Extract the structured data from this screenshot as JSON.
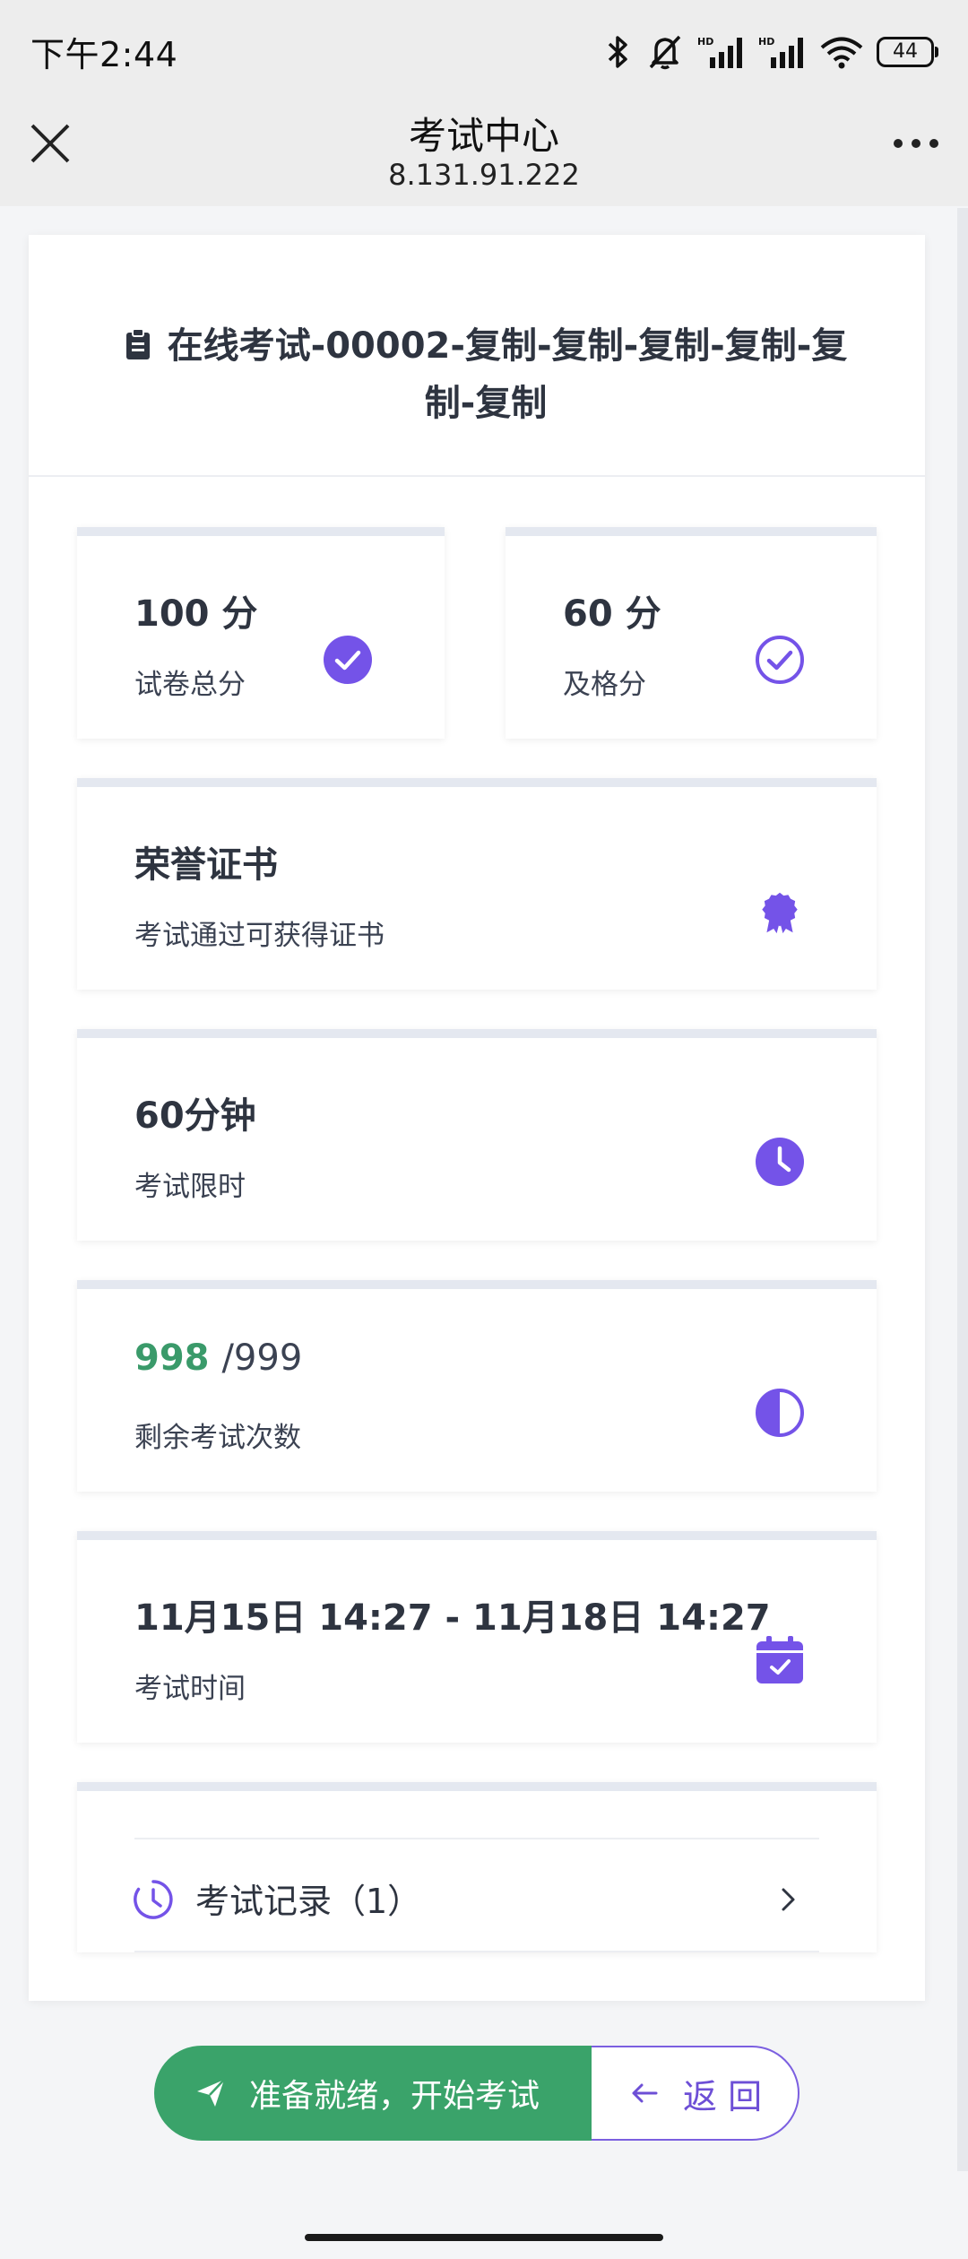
{
  "status_bar": {
    "time": "下午2:44",
    "battery": "44",
    "icons": [
      "bluetooth-icon",
      "mute-icon",
      "hd-signal-icon",
      "hd-signal-icon",
      "wifi-icon",
      "battery-icon"
    ]
  },
  "nav": {
    "title": "考试中心",
    "subtitle": "8.131.91.222",
    "close_icon": "close-icon",
    "more_icon": "more-icon"
  },
  "exam": {
    "title": "在线考试-00002-复制-复制-复制-复制-复制-复制",
    "title_icon": "clipboard-icon"
  },
  "cards": {
    "total_score": {
      "value": "100 分",
      "label": "试卷总分",
      "icon": "check-circle-filled-icon"
    },
    "pass_score": {
      "value": "60 分",
      "label": "及格分",
      "icon": "check-circle-outline-icon"
    },
    "certificate": {
      "value": "荣誉证书",
      "label": "考试通过可获得证书",
      "icon": "award-badge-icon"
    },
    "time_limit": {
      "value": "60分钟",
      "label": "考试限时",
      "icon": "clock-filled-icon"
    },
    "attempts": {
      "remaining": "998",
      "total": "/999",
      "label": "剩余考试次数",
      "icon": "half-circle-icon"
    },
    "exam_time": {
      "value": "11月15日 14:27 - 11月18日 14:27",
      "label": "考试时间",
      "icon": "calendar-check-icon"
    }
  },
  "records": {
    "label": "考试记录（1）",
    "icon": "history-clock-icon",
    "chevron": "chevron-right-icon"
  },
  "actions": {
    "start_label": "准备就绪，开始考试",
    "back_label": "返 回"
  },
  "colors": {
    "accent_purple": "#7453e8",
    "primary_green": "#3aa36a",
    "text_dark": "#2e3440",
    "card_top_border": "#e4e8f0"
  }
}
